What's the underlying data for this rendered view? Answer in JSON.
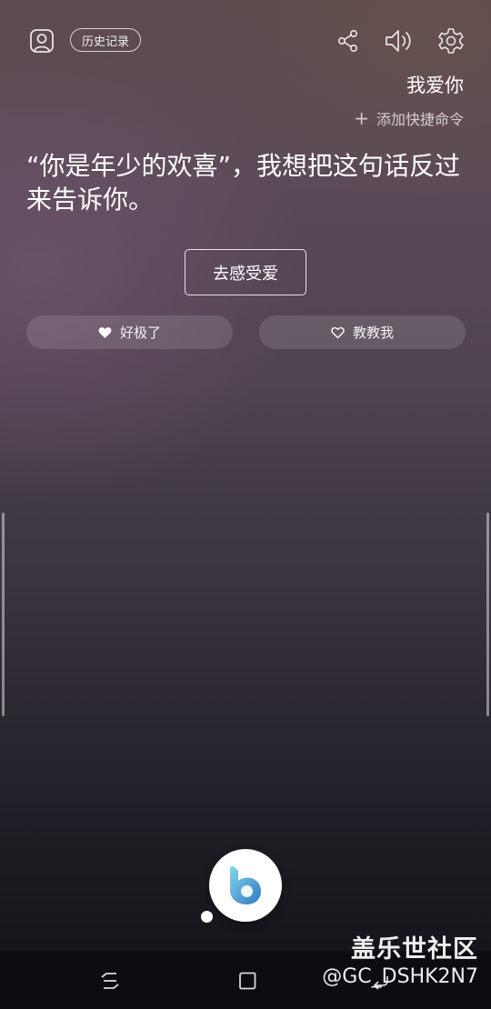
{
  "header": {
    "history_label": "历史记录",
    "icons": [
      "account-icon",
      "share-icon",
      "volume-icon",
      "settings-icon"
    ]
  },
  "conversation": {
    "query": "我爱你",
    "add_shortcut_label": "添加快捷命令",
    "response_text": "“你是年少的欢喜”，我想把这句话反过来告诉你。",
    "action_button_label": "去感受爱"
  },
  "feedback": {
    "good_label": "好极了",
    "teach_label": "教教我"
  },
  "navigation": {
    "icons": [
      "recent-apps-icon",
      "home-icon",
      "back-icon"
    ]
  },
  "watermark": {
    "title": "盖乐世社区",
    "user_id": "@GC_DSHK2N7"
  },
  "colors": {
    "bixby_gradient_start": "#7fd0e6",
    "bixby_gradient_end": "#2f78c6",
    "nav_bar": "#0c0d11"
  }
}
